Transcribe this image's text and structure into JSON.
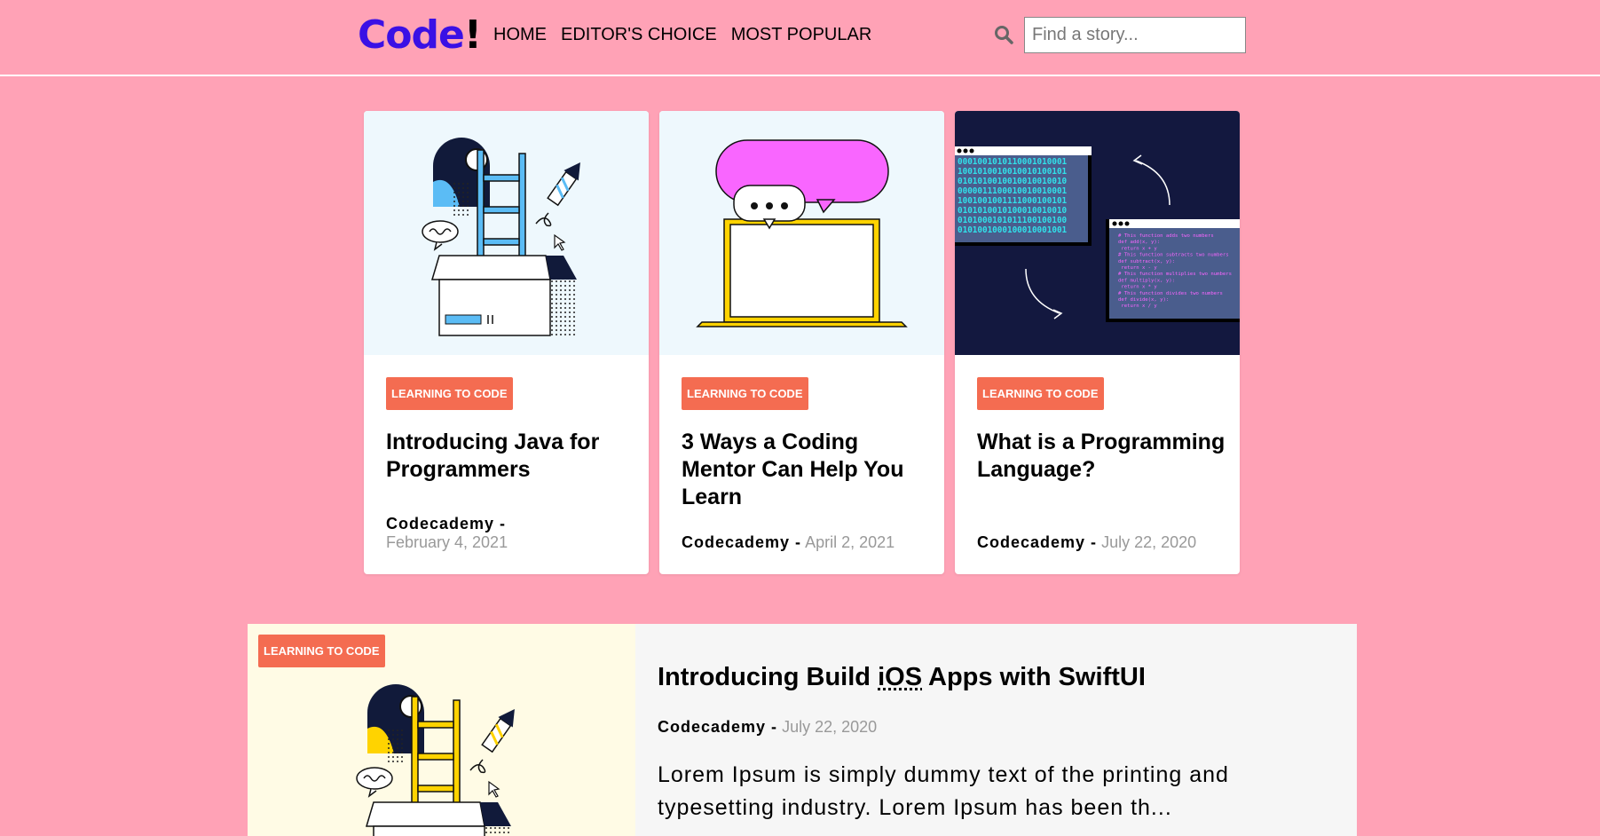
{
  "header": {
    "logo_main": "Code",
    "logo_bang": "!",
    "nav": [
      "HOME",
      "EDITOR'S CHOICE",
      "MOST POPULAR"
    ],
    "search_placeholder": "Find a story..."
  },
  "cards": [
    {
      "tag": "LEARNING TO CODE",
      "title": "Introducing Java for Programmers",
      "author": "Codecademy -",
      "date": "February 4, 2021",
      "image_icon": "ladder-box-illustration"
    },
    {
      "tag": "LEARNING TO CODE",
      "title": "3 Ways a Coding Mentor Can Help You Learn",
      "author": "Codecademy -",
      "date": "April 2, 2021",
      "image_icon": "laptop-speech-bubble-illustration"
    },
    {
      "tag": "LEARNING TO CODE",
      "title": "What is a Programming Language?",
      "author": "Codecademy -",
      "date": "July 22, 2020",
      "image_icon": "binary-code-windows-illustration"
    }
  ],
  "featured": {
    "tag": "LEARNING TO CODE",
    "title_before": "Introducing Build ",
    "title_abbr": "iOS",
    "title_after": " Apps with SwiftUI",
    "author": "Codecademy -",
    "date": "July 22, 2020",
    "excerpt": "Lorem Ipsum is simply dummy text of the printing and typesetting industry. Lorem Ipsum has been th...",
    "image_icon": "ladder-box-illustration-yellow"
  },
  "code_window": {
    "binary": [
      "0001001010110001010001",
      "1001010010010010100101",
      "0101010010010010010010",
      "0000011100010010010001",
      "1001001001111000100101",
      "0101010010100010010010",
      "0101000101011100100100",
      "0101001000100010001001"
    ],
    "code": [
      "# This function adds two numbers",
      "def add(x, y):",
      "    return x + y",
      "# This function subtracts two numbers",
      "def subtract(x, y):",
      "    return x - y",
      "# This function multiplies two numbers",
      "def multiply(x, y):",
      "    return x * y",
      "# This function divides two numbers",
      "def divide(x, y):",
      "    return x / y"
    ]
  },
  "colors": {
    "background": "#ffa2b6",
    "logo": "#3a10e5",
    "tag": "#f46c51"
  }
}
